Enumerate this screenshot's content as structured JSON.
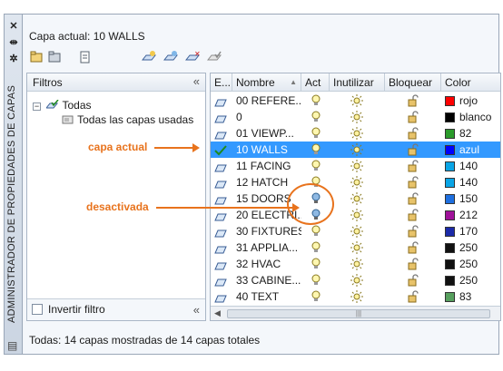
{
  "palette": {
    "vertical_title": "ADMINISTRADOR DE PROPIEDADES DE CAPAS",
    "current_layer_label": "Capa actual: 10 WALLS"
  },
  "filters": {
    "header": "Filtros",
    "tree": [
      {
        "label": "Todas"
      },
      {
        "label": "Todas las capas usadas"
      }
    ],
    "invert_filter_label": "Invertir filtro"
  },
  "columns": [
    "E...",
    "Nombre",
    "Act",
    "Inutilizar",
    "Bloquear",
    "Color"
  ],
  "layers": [
    {
      "name": "00 REFERE...",
      "color_name": "rojo",
      "color": "#ff0000",
      "on": true,
      "current": false
    },
    {
      "name": "0",
      "color_name": "blanco",
      "color": "#000000",
      "on": true,
      "current": false
    },
    {
      "name": "01 VIEWP...",
      "color_name": "82",
      "color": "#2b9b2b",
      "on": true,
      "current": false
    },
    {
      "name": "10 WALLS",
      "color_name": "azul",
      "color": "#0000ff",
      "on": true,
      "current": true
    },
    {
      "name": "11 FACING",
      "color_name": "140",
      "color": "#0aa5e6",
      "on": true,
      "current": false
    },
    {
      "name": "12 HATCH",
      "color_name": "140",
      "color": "#0aa5e6",
      "on": true,
      "current": false
    },
    {
      "name": "15 DOORS",
      "color_name": "150",
      "color": "#1e6fe0",
      "on": false,
      "current": false
    },
    {
      "name": "20 ELECTRI...",
      "color_name": "212",
      "color": "#a0119a",
      "on": false,
      "current": false
    },
    {
      "name": "30 FIXTURES",
      "color_name": "170",
      "color": "#1b2aa8",
      "on": true,
      "current": false
    },
    {
      "name": "31 APPLIA...",
      "color_name": "250",
      "color": "#111111",
      "on": true,
      "current": false
    },
    {
      "name": "32 HVAC",
      "color_name": "250",
      "color": "#111111",
      "on": true,
      "current": false
    },
    {
      "name": "33 CABINE...",
      "color_name": "250",
      "color": "#111111",
      "on": true,
      "current": false
    },
    {
      "name": "40 TEXT",
      "color_name": "83",
      "color": "#57a05e",
      "on": true,
      "current": false
    }
  ],
  "status_text": "Todas: 14 capas mostradas de 14 capas totales",
  "annotations": {
    "current": "capa actual",
    "off": "desactivada"
  },
  "accent_color": "#e8731d",
  "selection_color": "#3399ff"
}
